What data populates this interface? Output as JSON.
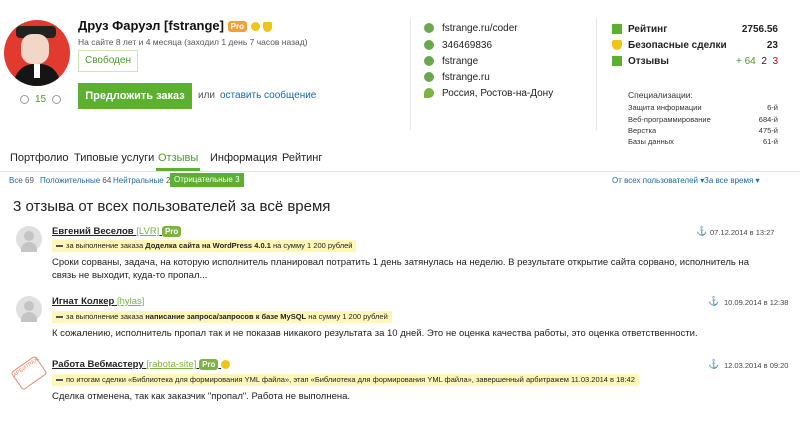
{
  "profile": {
    "name": "Друз Фаруэл [fstrange]",
    "pro": "Pro",
    "since": "На сайте 8 лет и 4 месяца (заходил 1 день 7 часов назад)",
    "status": "Свободен",
    "score": "15",
    "order_button": "Предложить заказ",
    "or_label": "или",
    "message_link": "оставить сообщение"
  },
  "contacts": [
    {
      "icon": "link-icon",
      "text": "fstrange.ru/coder"
    },
    {
      "icon": "skype-icon",
      "text": "346469836"
    },
    {
      "icon": "skype-icon",
      "text": "fstrange"
    },
    {
      "icon": "skype-icon",
      "text": "fstrange.ru"
    },
    {
      "icon": "location-icon",
      "text": "Россия, Ростов-на-Дону"
    }
  ],
  "stats": {
    "rating_label": "Рейтинг",
    "rating_value": "2756.56",
    "safe_label": "Безопасные сделки",
    "safe_value": "23",
    "reviews_label": "Отзывы",
    "reviews_pos": "+ 64",
    "reviews_neutral": "2",
    "reviews_neg": "3",
    "specs_title": "Специализации:",
    "specs": [
      {
        "name": "Защита информации",
        "value": "6-й"
      },
      {
        "name": "Веб-программирование",
        "value": "684-й"
      },
      {
        "name": "Верстка",
        "value": "475-й"
      },
      {
        "name": "Базы данных",
        "value": "61-й"
      }
    ]
  },
  "tabs": [
    "Портфолио",
    "Типовые услуги",
    "Отзывы",
    "Информация",
    "Рейтинг"
  ],
  "filters": {
    "all_label": "Все",
    "all_count": "69",
    "pos_label": "Положительные",
    "pos_count": "64",
    "neu_label": "Нейтральные",
    "neu_count": "2",
    "neg_label": "Отрицательные 3",
    "from_all": "От всех пользователей",
    "all_time": "За все время"
  },
  "heading": "3 отзыва от всех пользователей за всё время",
  "reviews": [
    {
      "name": "Евгений Веселов",
      "login": "[LVR]",
      "pro": "Pro",
      "date": "07.12.2014 в 13:27",
      "ctx_pre": "за выполнение заказа",
      "ctx_bold": "Доделка сайта на WordPress 4.0.1",
      "ctx_post": "на сумму 1 200 рублей",
      "text": "Сроки сорваны, задача, на которую исполнитель планировал потратить 1 день затянулась на неделю. В результате открытие сайта сорвано, исполнитель на связь не выходит, куда-то пропал..."
    },
    {
      "name": "Игнат Колкер",
      "login": "[hylas]",
      "date": "10.09.2014 в 12:38",
      "ctx_pre": "за выполнение заказа",
      "ctx_bold": "написание запроса/запросов к базе MySQL",
      "ctx_post": "на сумму 1 200 рублей",
      "text": "К сожалению, исполнитель пропал так и не показав никакого результата за 10 дней. Это не оценка качества работы, это оценка ответственности."
    },
    {
      "name": "Работа Вебмастеру",
      "login": "[rabota-site]",
      "pro": "Pro",
      "date": "12.03.2014 в 09:20",
      "ctx_full": "по итогам сделки «Библиотека для формирования YML файла», этап «Библиотека для формирования YML файла», завершенный арбитражем 11.03.2014 в 18:42",
      "text": "Сделка отменена, так как заказчик \"пропал\". Работа не выполнена.",
      "stamp": "АРБИТРАЖ"
    }
  ],
  "colors": {
    "accent": "#5bb02f",
    "link": "#1a6aa5",
    "highlight": "#fff7b8"
  }
}
